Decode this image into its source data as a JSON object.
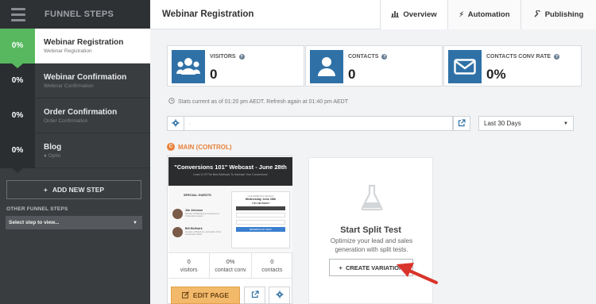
{
  "sidebar": {
    "title": "FUNNEL STEPS",
    "steps": [
      {
        "pct": "0%",
        "name": "Webinar Registration",
        "sub": "Webinar Registration",
        "active": true
      },
      {
        "pct": "0%",
        "name": "Webinar Confirmation",
        "sub": "Webinar Confirmation",
        "active": false
      },
      {
        "pct": "0%",
        "name": "Order Confirmation",
        "sub": "Order Confirmation",
        "active": false
      },
      {
        "pct": "0%",
        "name": "Blog",
        "sub": "Optin",
        "active": false
      }
    ],
    "add_step_label": "ADD NEW STEP",
    "other_steps_label": "OTHER FUNNEL STEPS",
    "other_steps_select": "Select step to view..."
  },
  "header": {
    "title": "Webinar Registration",
    "tabs": [
      {
        "label": "Overview",
        "icon": "bar-chart-icon",
        "active": true
      },
      {
        "label": "Automation",
        "icon": "bolt-icon",
        "active": false
      },
      {
        "label": "Publishing",
        "icon": "wrench-icon",
        "active": false
      }
    ]
  },
  "stats": {
    "visitors": {
      "label": "VISITORS",
      "value": "0"
    },
    "contacts": {
      "label": "CONTACTS",
      "value": "0"
    },
    "conv_rate": {
      "label": "CONTACTS CONV RATE",
      "value": "0%"
    },
    "note": "Stats current as of 01:20 pm AEDT. Refresh again at 01:40 pm AEDT"
  },
  "url_bar": {
    "value": "."
  },
  "date_range": {
    "selected": "Last 30 Days"
  },
  "main_label": {
    "badge": "C",
    "text": "MAIN (CONTROL)"
  },
  "preview": {
    "thumb_title": "\"Conversions 101\" Webcast - June 28th",
    "thumb_sub": "Learn 5 Of The Best Methods To Increase Your Conversions",
    "guests_heading": "SPECIAL GUESTS",
    "guests": [
      {
        "name": "Jim Johnson",
        "desc": "Director of Marketing at Company Inc. Conversions expert"
      },
      {
        "name": "Bill McGwirk",
        "desc": "Founder of Brand Co. and author of the Conversions Book"
      }
    ],
    "reg_heading": "LIVE WEBCAST DETAILS",
    "reg_date": "Wednesday, June 28th",
    "reg_time": "7:00 AM PHEST",
    "reg_button": "RESERVE MY SEAT",
    "stats": [
      {
        "value": "0",
        "label": "visitors"
      },
      {
        "value": "0%",
        "label": "contact conv"
      },
      {
        "value": "0",
        "label": "contacts"
      }
    ],
    "edit_label": "EDIT PAGE"
  },
  "split_test": {
    "title": "Start Split Test",
    "desc": "Optimize your lead and sales generation with split tests.",
    "button": "CREATE VARIATION"
  },
  "colors": {
    "accent_green": "#57b85f",
    "brand_blue": "#2f71a6",
    "orange": "#e8833a",
    "arrow_red": "#d9342b"
  }
}
